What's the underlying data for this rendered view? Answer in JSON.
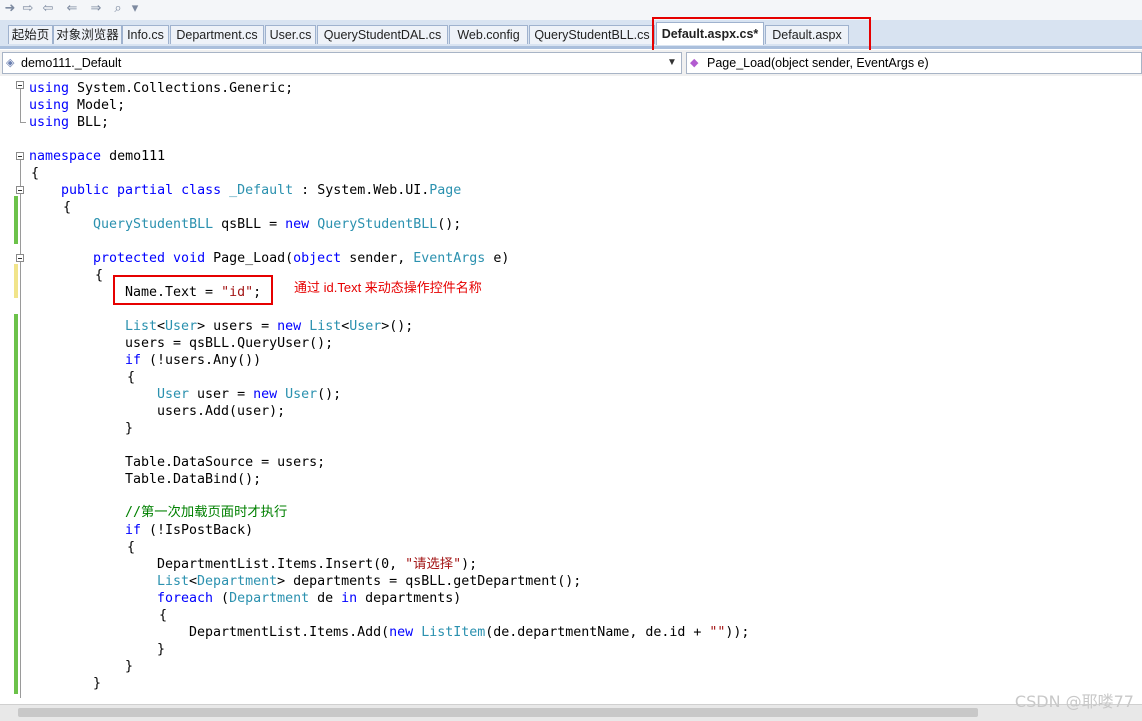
{
  "tabs": [
    {
      "label": "起始页"
    },
    {
      "label": "对象浏览器"
    },
    {
      "label": "Info.cs"
    },
    {
      "label": "Department.cs"
    },
    {
      "label": "User.cs"
    },
    {
      "label": "QueryStudentDAL.cs"
    },
    {
      "label": "Web.config"
    },
    {
      "label": "QueryStudentBLL.cs"
    },
    {
      "label": "Default.aspx.cs*",
      "active": true
    },
    {
      "label": "Default.aspx"
    }
  ],
  "dropdowns": {
    "type": "demo111._Default",
    "member": "Page_Load(object sender, EventArgs e)"
  },
  "code": {
    "l1": [
      "using",
      " System.Collections.Generic;"
    ],
    "l2": [
      "using",
      " Model;"
    ],
    "l3": [
      "using",
      " BLL;"
    ],
    "l5": [
      "namespace",
      " demo111"
    ],
    "l6": "{",
    "l7": [
      "public partial class",
      "_Default",
      " : System.Web.UI.",
      "Page"
    ],
    "l8": "{",
    "l9": [
      "QueryStudentBLL",
      " qsBLL = ",
      "new",
      "QueryStudentBLL",
      "();"
    ],
    "l11": [
      "protected void",
      " Page_Load(",
      "object",
      " sender, ",
      "EventArgs",
      " e)"
    ],
    "l12": "{",
    "l13": [
      "Name.Text = ",
      "\"id\"",
      ";"
    ],
    "l15": [
      "List",
      "<",
      "User",
      "> users = ",
      "new",
      "List",
      "<",
      "User",
      ">();"
    ],
    "l16": "users = qsBLL.QueryUser();",
    "l17": [
      "if",
      " (!users.Any())"
    ],
    "l18": "{",
    "l19": [
      "User",
      " user = ",
      "new",
      "User",
      "();"
    ],
    "l20": "users.Add(user);",
    "l21": "}",
    "l23": "Table.DataSource = users;",
    "l24": "Table.DataBind();",
    "l26": "//第一次加载页面时才执行",
    "l27": [
      "if",
      " (!IsPostBack)"
    ],
    "l28": "{",
    "l29": [
      "DepartmentList.Items.Insert(0, ",
      "\"请选择\"",
      ");"
    ],
    "l30": [
      "List",
      "<",
      "Department",
      "> departments = qsBLL.getDepartment();"
    ],
    "l31": [
      "foreach",
      " (",
      "Department",
      " de ",
      "in",
      " departments)"
    ],
    "l32": "{",
    "l33": [
      "DepartmentList.Items.Add(",
      "new",
      "ListItem",
      "(de.departmentName, de.id + ",
      "\"\"",
      "));"
    ],
    "l34": "}",
    "l35": "}",
    "l36": "}"
  },
  "annotation": "通过 id.Text 来动态操作控件名称",
  "watermark": "CSDN @耶喽77",
  "colors": {
    "keyword": "#0000ff",
    "type": "#2b91af",
    "string": "#a31515",
    "comment": "#008000",
    "highlight_box": "#e60000"
  }
}
